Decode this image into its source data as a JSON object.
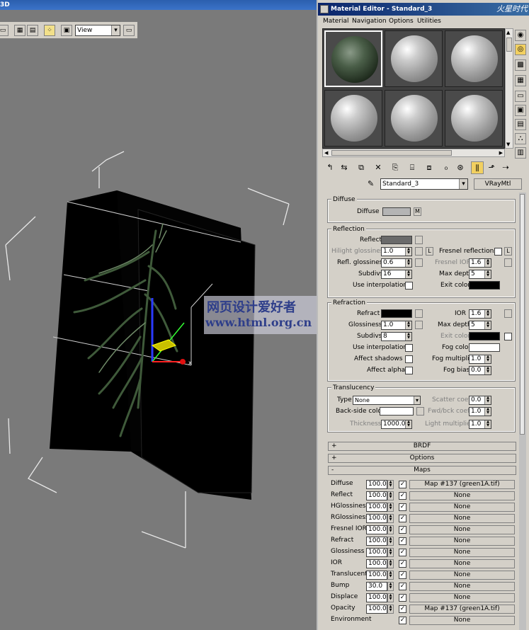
{
  "viewport": {
    "title_fragment": "3D",
    "view_select": "View",
    "watermark_line1": "网页设计爱好者",
    "watermark_line2": "www.html.org.cn"
  },
  "material_editor": {
    "title": "Material Editor - Standard_3",
    "logo": "火星时代",
    "menu": [
      "Material",
      "Navigation",
      "Options",
      "Utilities"
    ],
    "material_name": "Standard_3",
    "material_type": "VRayMtl",
    "diffuse": {
      "group_label": "Diffuse",
      "label": "Diffuse",
      "color": "#b4b4b4",
      "map_btn": "M"
    },
    "reflection": {
      "group_label": "Reflection",
      "reflect_label": "Reflect",
      "reflect_color": "#6a6a6a",
      "hilight_label": "Hilight glossiness",
      "hilight_value": "1.0",
      "lock_btn": "L",
      "fresnel_reflections_label": "Fresnel reflections",
      "refl_gloss_label": "Refl. glossiness",
      "refl_gloss_value": "0.6",
      "fresnel_ior_label": "Fresnel IOR",
      "fresnel_ior_value": "1.6",
      "subdivs_label": "Subdivs",
      "subdivs_value": "16",
      "max_depth_label": "Max depth",
      "max_depth_value": "5",
      "use_interp_label": "Use interpolation",
      "exit_color_label": "Exit color",
      "exit_color": "#000000"
    },
    "refraction": {
      "group_label": "Refraction",
      "refract_label": "Refract",
      "refract_color": "#000000",
      "ior_label": "IOR",
      "ior_value": "1.6",
      "gloss_label": "Glossiness",
      "gloss_value": "1.0",
      "max_depth_label": "Max depth",
      "max_depth_value": "5",
      "subdivs_label": "Subdivs",
      "subdivs_value": "8",
      "exit_color_label": "Exit color",
      "exit_color": "#000000",
      "use_interp_label": "Use interpolation",
      "fog_color_label": "Fog color",
      "fog_color": "#ffffff",
      "affect_shadows_label": "Affect shadows",
      "fog_mult_label": "Fog multiplier",
      "fog_mult_value": "1.0",
      "affect_alpha_label": "Affect alpha",
      "fog_bias_label": "Fog bias",
      "fog_bias_value": "0.0"
    },
    "translucency": {
      "group_label": "Translucency",
      "type_label": "Type",
      "type_value": "None",
      "scatter_label": "Scatter coeff",
      "scatter_value": "0.0",
      "backside_label": "Back-side color",
      "backside_color": "#ffffff",
      "fwd_label": "Fwd/bck coeff",
      "fwd_value": "1.0",
      "thickness_label": "Thickness",
      "thickness_value": "1000.0",
      "light_mult_label": "Light multiplier",
      "light_mult_value": "1.0"
    },
    "rollouts": {
      "brdf": "BRDF",
      "options": "Options",
      "maps": "Maps",
      "plus": "+",
      "minus": "-"
    },
    "maps": [
      {
        "name": "Diffuse",
        "value": "100.0",
        "checked": "✓",
        "map": "Map #137 (green1A.tif)"
      },
      {
        "name": "Reflect",
        "value": "100.0",
        "checked": "✓",
        "map": "None"
      },
      {
        "name": "HGlossiness",
        "value": "100.0",
        "checked": "✓",
        "map": "None"
      },
      {
        "name": "RGlossiness",
        "value": "100.0",
        "checked": "✓",
        "map": "None"
      },
      {
        "name": "Fresnel IOR",
        "value": "100.0",
        "checked": "✓",
        "map": "None"
      },
      {
        "name": "Refract",
        "value": "100.0",
        "checked": "✓",
        "map": "None"
      },
      {
        "name": "Glossiness",
        "value": "100.0",
        "checked": "✓",
        "map": "None"
      },
      {
        "name": "IOR",
        "value": "100.0",
        "checked": "✓",
        "map": "None"
      },
      {
        "name": "Translucent",
        "value": "100.0",
        "checked": "✓",
        "map": "None"
      },
      {
        "name": "Bump",
        "value": "30.0",
        "checked": "✓",
        "map": "None"
      },
      {
        "name": "Displace",
        "value": "100.0",
        "checked": "✓",
        "map": "None"
      },
      {
        "name": "Opacity",
        "value": "100.0",
        "checked": "✓",
        "map": "Map #137 (green1A.tif)"
      },
      {
        "name": "Environment",
        "value": "",
        "checked": "✓",
        "map": "None"
      }
    ]
  }
}
